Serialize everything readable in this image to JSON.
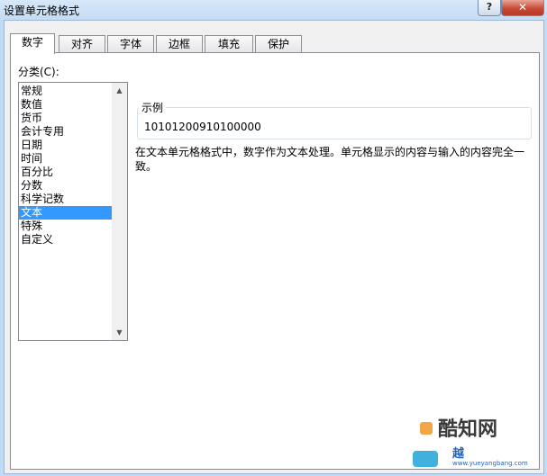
{
  "window": {
    "title": "设置单元格格式",
    "help_label": "?",
    "close_label": "✕"
  },
  "tabs": [
    {
      "label": "数字",
      "active": true
    },
    {
      "label": "对齐"
    },
    {
      "label": "字体"
    },
    {
      "label": "边框"
    },
    {
      "label": "填充"
    },
    {
      "label": "保护"
    }
  ],
  "category": {
    "label": "分类(C):",
    "items": [
      "常规",
      "数值",
      "货币",
      "会计专用",
      "日期",
      "时间",
      "百分比",
      "分数",
      "科学记数",
      "文本",
      "特殊",
      "自定义"
    ],
    "selected": "文本"
  },
  "sample": {
    "legend": "示例",
    "value": "10101200910100000"
  },
  "description": "在文本单元格格式中，数字作为文本处理。单元格显示的内容与输入的内容完全一致。",
  "watermark": {
    "line1": "酷知网",
    "line2": "越",
    "line3": "www.yueyangbang.com"
  },
  "colors": {
    "selection": "#3399ff",
    "title_bar": "#c4dcf4",
    "close_button": "#c74a36"
  }
}
